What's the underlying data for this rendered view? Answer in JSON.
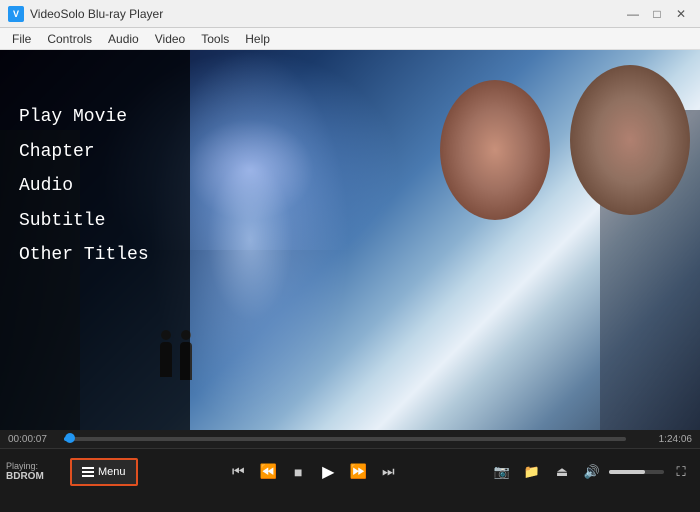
{
  "app": {
    "title": "VideoSolo Blu-ray Player",
    "logo_text": "V"
  },
  "title_bar": {
    "minimize": "—",
    "maximize": "□",
    "close": "✕"
  },
  "menu_bar": {
    "items": [
      "File",
      "Controls",
      "Audio",
      "Video",
      "Tools",
      "Help"
    ]
  },
  "context_menu": {
    "items": [
      "Play Movie",
      "Chapter",
      "Audio",
      "Subtitle",
      "Other Titles"
    ]
  },
  "timeline": {
    "current_time": "00:00:07",
    "total_time": "1:24:06",
    "progress_percent": 1
  },
  "controls": {
    "menu_label": "Menu",
    "playing_label": "Playing:",
    "playing_source": "BDROM"
  },
  "transport": {
    "prev": "⏮",
    "rewind": "⏪",
    "stop": "■",
    "play": "▶",
    "fast_forward": "⏩",
    "next": "⏭"
  },
  "right_controls": {
    "screenshot_icon": "📷",
    "folder_icon": "📁",
    "eject_icon": "⏏",
    "volume_icon": "🔊",
    "fullscreen_icon": "⛶"
  }
}
